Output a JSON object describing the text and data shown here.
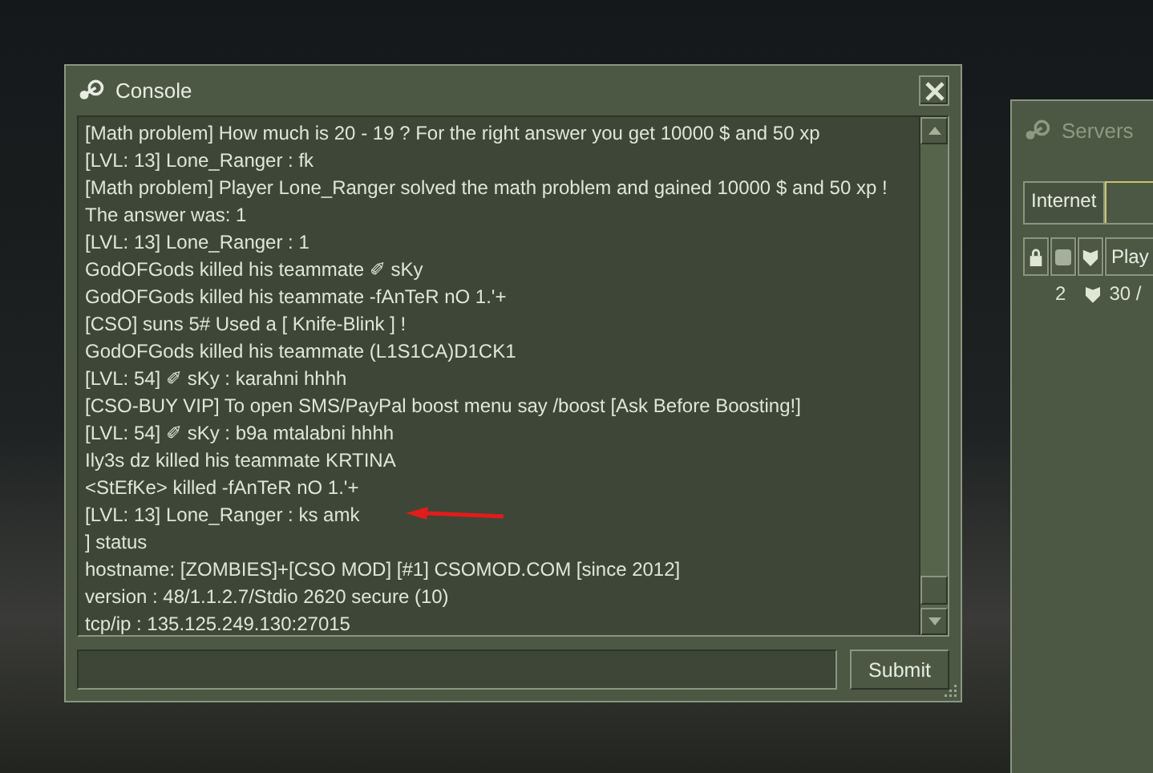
{
  "console": {
    "title": "Console",
    "lines": [
      {
        "text": "[Math problem] How much is 20 - 19 ? For the right answer you get 10000 $ and 50 xp",
        "annotated": false
      },
      {
        "text": "[LVL: 13] Lone_Ranger : fk",
        "annotated": false
      },
      {
        "text": "[Math problem] Player Lone_Ranger solved the math problem and gained 10000 $ and 50 xp ! The answer was: 1",
        "annotated": false
      },
      {
        "text": "[LVL: 13] Lone_Ranger : 1",
        "annotated": false
      },
      {
        "text": "GodOFGods killed his teammate ✐ sKy",
        "annotated": false
      },
      {
        "text": "GodOFGods killed his teammate -fAnTeR nO 1.'+",
        "annotated": false
      },
      {
        "text": "[CSO] suns 5#  Used a [ Knife-Blink ] !",
        "annotated": false
      },
      {
        "text": "GodOFGods killed his teammate (L1S1CA)D1CK1",
        "annotated": false
      },
      {
        "text": "[LVL: 54] ✐ sKy : karahni hhhh",
        "annotated": false
      },
      {
        "text": "[CSO-BUY VIP] To open SMS/PayPal boost menu say /boost [Ask Before Boosting!]",
        "annotated": false
      },
      {
        "text": "[LVL: 54] ✐ sKy : b9a mtalabni hhhh",
        "annotated": false
      },
      {
        "text": "Ily3s dz killed his teammate KRTINA",
        "annotated": false
      },
      {
        "text": "<StEfKe> killed -fAnTeR nO 1.'+",
        "annotated": false
      },
      {
        "text": "[LVL: 13] Lone_Ranger : ks amk",
        "annotated": true
      },
      {
        "text": "] status",
        "annotated": false
      },
      {
        "text": "hostname:  [ZOMBIES]+[CSO MOD] [#1] CSOMOD.COM [since 2012]",
        "annotated": false
      },
      {
        "text": "version :  48/1.1.2.7/Stdio 2620 secure  (10)",
        "annotated": false
      },
      {
        "text": "tcp/ip  :  135.125.249.130:27015",
        "annotated": false
      }
    ],
    "submit": "Submit"
  },
  "servers": {
    "title": "Servers",
    "tabs": [
      {
        "label": "Internet",
        "selected": false
      },
      {
        "selected": true
      }
    ],
    "columns": [
      "Play"
    ],
    "row": {
      "count": "2",
      "players": "30 /"
    }
  }
}
